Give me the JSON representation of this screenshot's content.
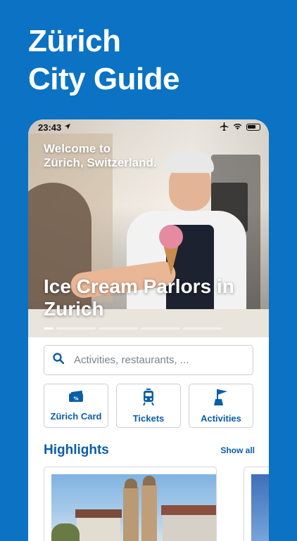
{
  "promo": {
    "line1": "Zürich",
    "line2": "City Guide"
  },
  "status_bar": {
    "time": "23:43"
  },
  "hero": {
    "welcome_line1": "Welcome to",
    "welcome_line2": "Zürich, Switzerland.",
    "title_line1": "Ice Cream Parlors in",
    "title_line2": "Zurich",
    "pages": 5,
    "active_page": 0
  },
  "search": {
    "placeholder": "Activities, restaurants, ..."
  },
  "tiles": [
    {
      "label": "Zürich Card",
      "icon": "zurich-card-icon"
    },
    {
      "label": "Tickets",
      "icon": "tram-icon"
    },
    {
      "label": "Activities",
      "icon": "flag-icon"
    }
  ],
  "highlights": {
    "title": "Highlights",
    "show_all": "Show all"
  },
  "colors": {
    "background": "#0b72c4",
    "accent": "#0b5ea8"
  }
}
